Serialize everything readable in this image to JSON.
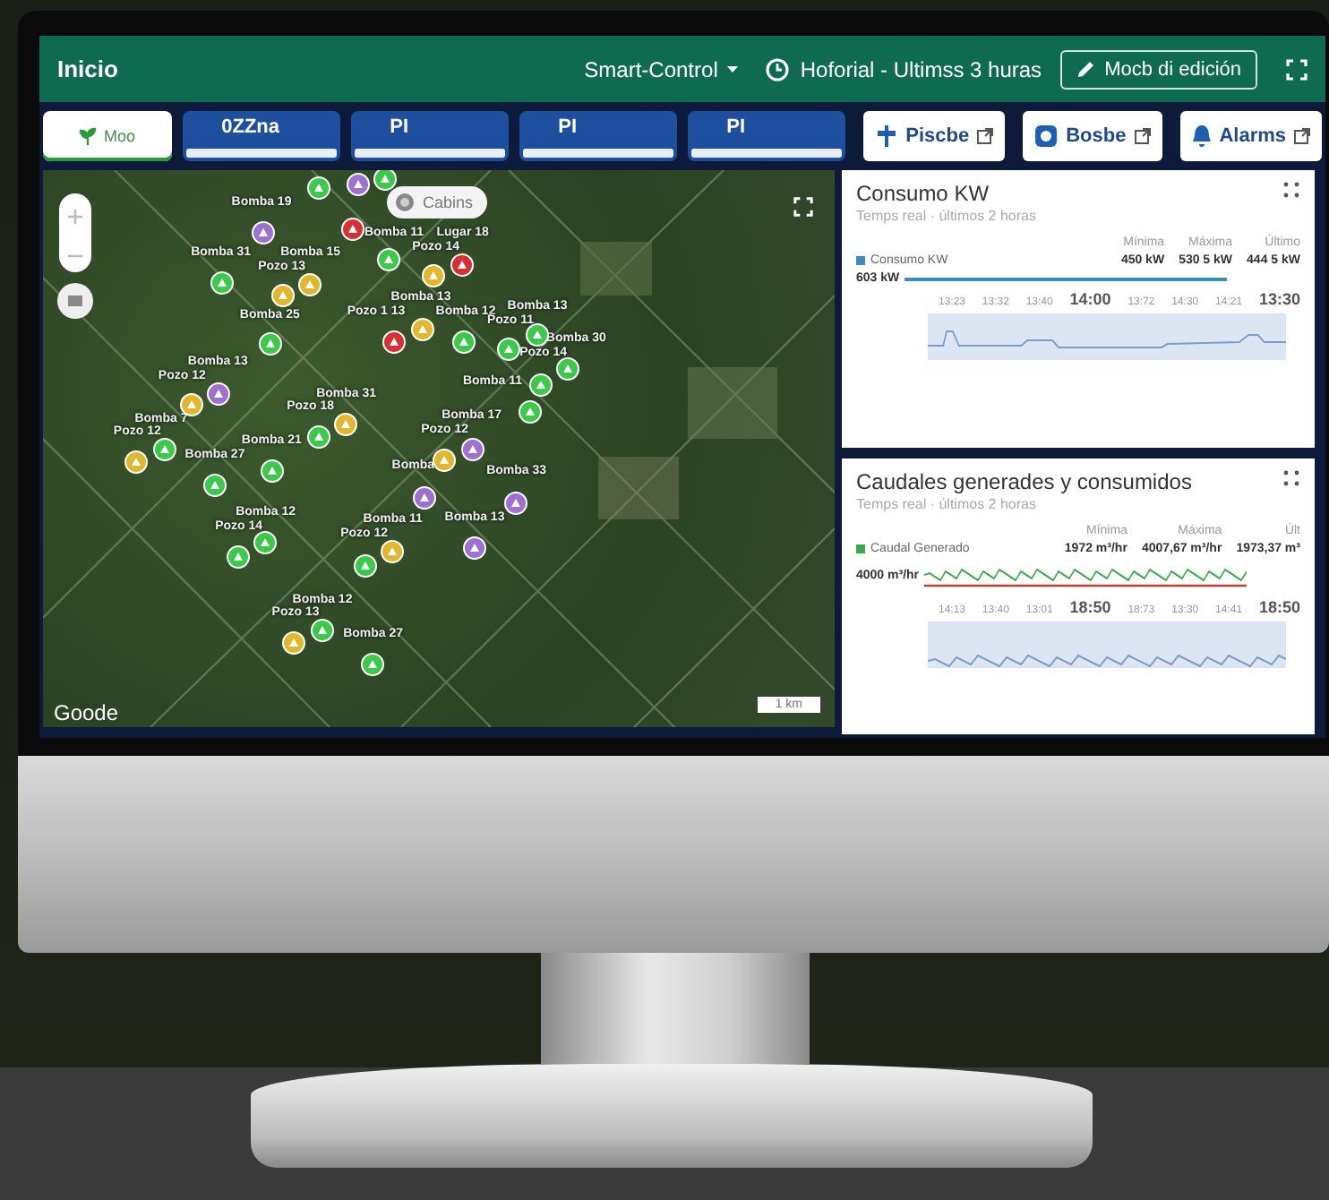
{
  "header": {
    "title": "Inicio",
    "app_menu": "Smart-Control",
    "history": "Hoforial - Ultimss 3 huras",
    "edit_button": "Mocb di edición"
  },
  "tabs": [
    {
      "label": "Moo",
      "kind": "home",
      "selected": true
    },
    {
      "label": "0ZZna",
      "kind": "zone",
      "selected": false
    },
    {
      "label": "PI",
      "kind": "zone",
      "selected": false
    },
    {
      "label": "PI",
      "kind": "zone",
      "selected": false
    },
    {
      "label": "PI",
      "kind": "zone",
      "selected": false
    }
  ],
  "actions": [
    {
      "label": "Piscbe",
      "kind": "tap"
    },
    {
      "label": "Bosbe",
      "kind": "pump"
    },
    {
      "label": "Alarms",
      "kind": "bell"
    }
  ],
  "map": {
    "layer_button": "Cabins",
    "attribution": "Goode",
    "scale": "1 km",
    "markers": [
      {
        "color": "#3cc84a"
      },
      {
        "color": "#a070d0"
      },
      {
        "color": "#3cc84a"
      },
      {
        "color": "#a070d0"
      },
      {
        "color": "#d83030"
      },
      {
        "color": "#3cc84a"
      },
      {
        "color": "#e0b830"
      },
      {
        "color": "#d83030"
      },
      {
        "color": "#3cc84a"
      },
      {
        "color": "#e0b830"
      },
      {
        "color": "#e0b830"
      },
      {
        "color": "#d83030"
      },
      {
        "color": "#e0b830"
      },
      {
        "color": "#3cc84a"
      },
      {
        "color": "#3cc84a"
      },
      {
        "color": "#3cc84a"
      },
      {
        "color": "#3cc84a"
      },
      {
        "color": "#3cc84a"
      },
      {
        "color": "#3cc84a"
      },
      {
        "color": "#3cc84a"
      },
      {
        "color": "#e0b830"
      },
      {
        "color": "#a070d0"
      },
      {
        "color": "#3cc84a"
      },
      {
        "color": "#e0b830"
      },
      {
        "color": "#3cc84a"
      },
      {
        "color": "#e0b830"
      },
      {
        "color": "#3cc84a"
      },
      {
        "color": "#3cc84a"
      },
      {
        "color": "#a070d0"
      },
      {
        "color": "#e0b830"
      },
      {
        "color": "#a070d0"
      },
      {
        "color": "#a070d0"
      },
      {
        "color": "#a070d0"
      },
      {
        "color": "#3cc84a"
      },
      {
        "color": "#3cc84a"
      },
      {
        "color": "#3cc84a"
      },
      {
        "color": "#e0b830"
      },
      {
        "color": "#e0b830"
      },
      {
        "color": "#3cc84a"
      },
      {
        "color": "#3cc84a"
      }
    ],
    "labels": [
      "Bomba 19",
      "Bomba 31",
      "Bomba 15",
      "Pozo 13",
      "Bomba 25",
      "Bomba 11",
      "Lugar 18",
      "Pozo 14",
      "Bomba 13",
      "Pozo 1 13",
      "Bomba 12",
      "Bomba 13",
      "Pozo 11",
      "Bomba 30",
      "Pozo 14",
      "Bomba 11",
      "Bomba 13",
      "Pozo 12",
      "Bomba 31",
      "Pozo 18",
      "Bomba 7",
      "Pozo 12",
      "Bomba 21",
      "Bomba 27",
      "Bomba 17",
      "Pozo 12",
      "Bomba",
      "Bomba 33",
      "Bomba 12",
      "Pozo 14",
      "Bomba 11",
      "Pozo 12",
      "Bomba 13",
      "Bomba 12",
      "Pozo 13",
      "Bomba 27"
    ]
  },
  "cards": [
    {
      "title": "Consumo KW",
      "subtitle": "Temps real · últimos 2 horas",
      "columns": [
        "Mínima",
        "Máxima",
        "Último"
      ],
      "series": {
        "name": "Consumo KW",
        "color": "#3a8fc0",
        "values": [
          "450 kW",
          "530 5 kW",
          "444 5 kW"
        ]
      },
      "y_label": "603 kW",
      "times": [
        "13:23",
        "13:32",
        "13:40",
        "14:00",
        "13:72",
        "14:30",
        "14:21",
        "13:30"
      ]
    },
    {
      "title": "Caudales generades y consumidos",
      "subtitle": "Temps real · últimos 2 horas",
      "columns": [
        "Mínima",
        "Máxima",
        "Últ"
      ],
      "series": {
        "name": "Caudal Generado",
        "color": "#3aa84a",
        "values": [
          "1972 m³/hr",
          "4007,67 m³/hr",
          "1973,37 m³"
        ]
      },
      "y_label": "4000 m³/hr",
      "times": [
        "14:13",
        "13:40",
        "13:01",
        "18:50",
        "18:73",
        "13:30",
        "14:41",
        "18:50"
      ]
    }
  ]
}
